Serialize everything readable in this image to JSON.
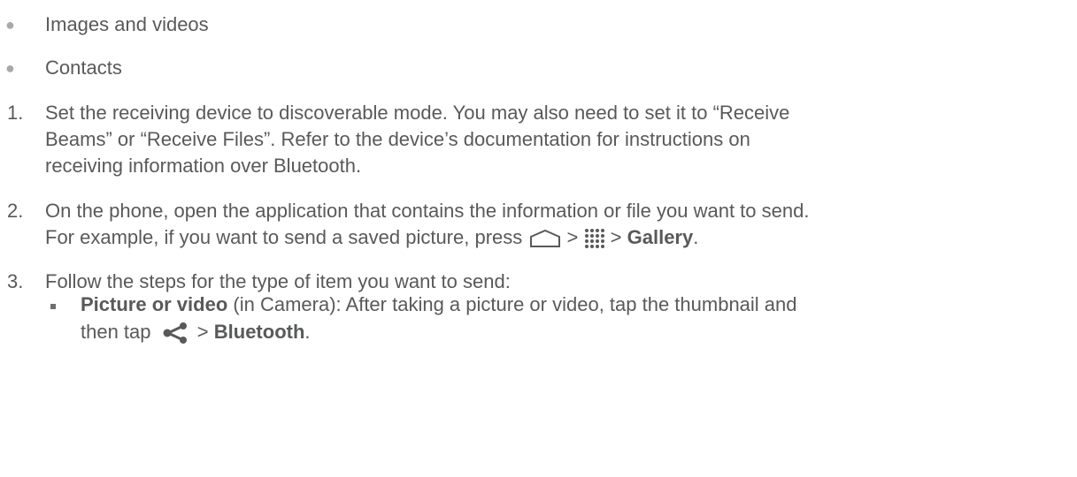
{
  "bullets": [
    {
      "text": "Images and videos"
    },
    {
      "text": "Contacts"
    }
  ],
  "steps": [
    {
      "number": "1.",
      "lines": [
        "Set the receiving device to discoverable mode. You may also need to set it to “Receive",
        "Beams” or “Receive Files”. Refer to the device’s documentation for instructions on",
        "receiving information over Bluetooth."
      ]
    },
    {
      "number": "2.",
      "line1": "On the phone, open the application that contains the information or file you want to send.",
      "line2_prefix": "For example, if you want to send a saved picture, press",
      "sep1": ">",
      "sep2": ">",
      "gallery": "Gallery",
      "period": "."
    },
    {
      "number": "3.",
      "line1": "Follow the steps for the type of item you want to send:"
    }
  ],
  "subitem": {
    "bold": "Picture or video",
    "rest1": " (in Camera): After taking a picture or video, tap the thumbnail and",
    "line2_prefix": "then tap",
    "sep": ">",
    "bluetooth": "Bluetooth",
    "period": "."
  },
  "icons": [
    "home-icon",
    "apps-icon",
    "share-icon"
  ]
}
